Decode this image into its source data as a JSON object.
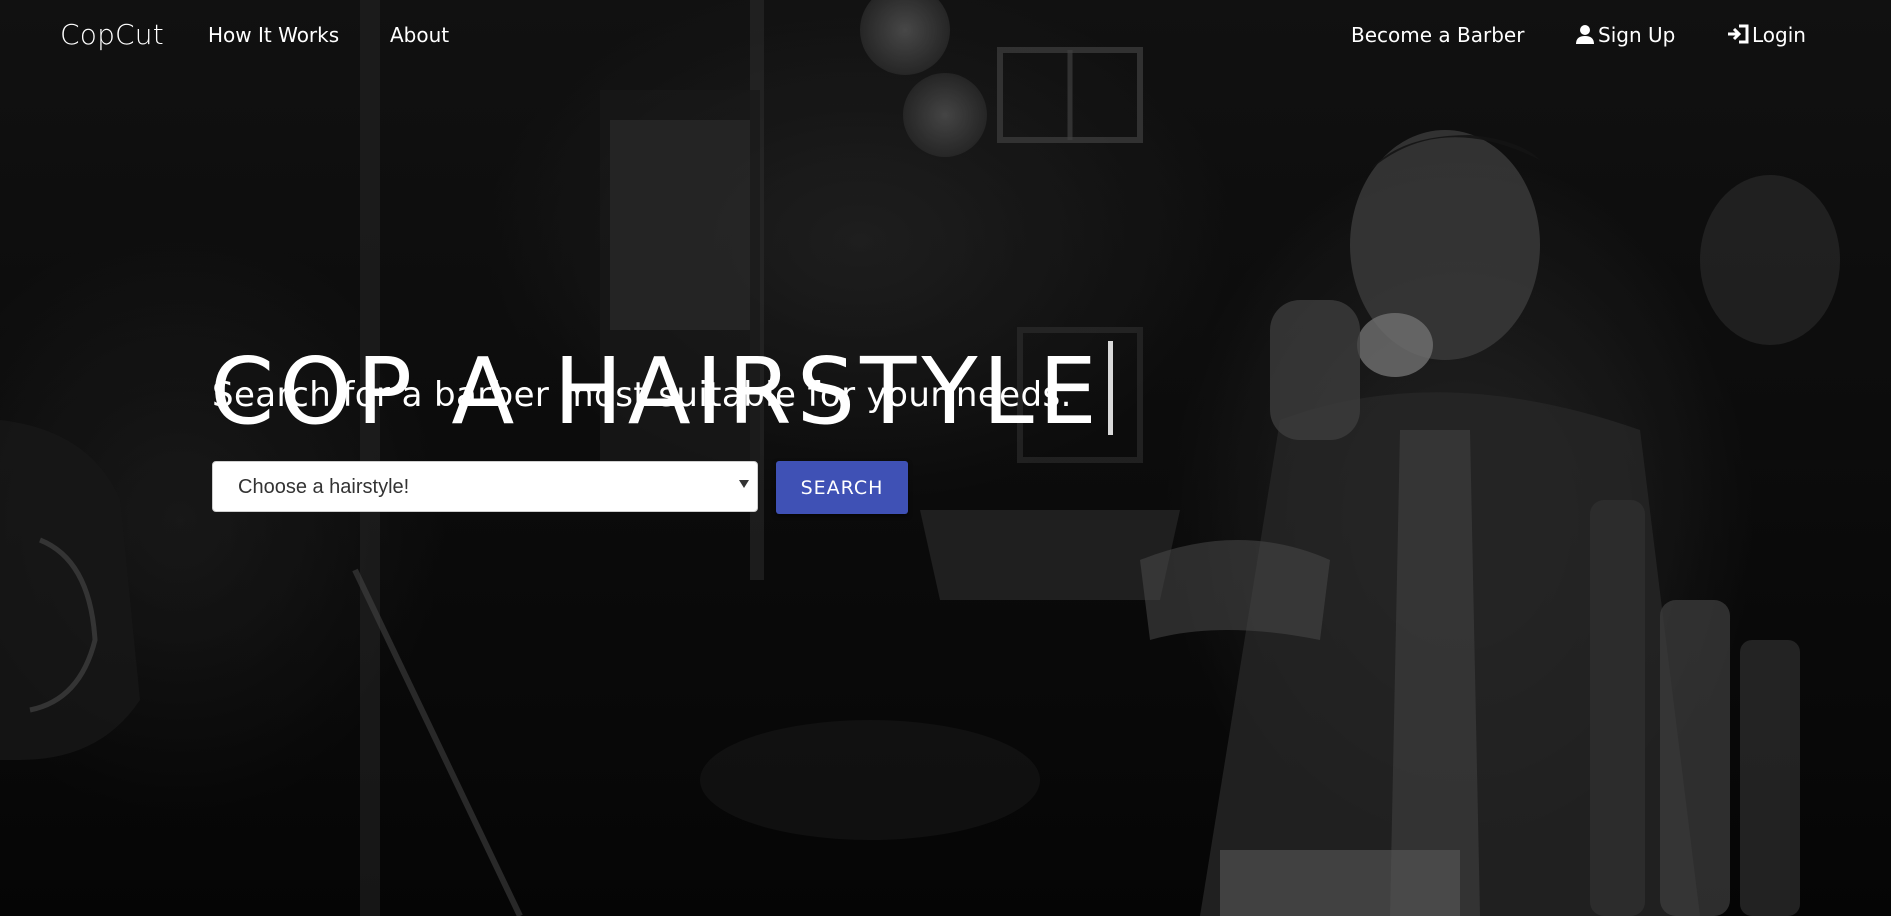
{
  "navbar": {
    "brand": "CopCut",
    "left_links": [
      "How It Works",
      "About"
    ],
    "right_links": {
      "become_barber": "Become a Barber",
      "sign_up": "Sign Up",
      "login": "Login"
    },
    "icons": {
      "sign_up": "user-icon",
      "login": "login-icon"
    }
  },
  "hero": {
    "title": "COP A HAIRSTYLE",
    "subtitle": "Search for a barber most suitable for your needs."
  },
  "search": {
    "select_value": "Choose a hairstyle!",
    "button_label": "SEARCH",
    "button_color": "#3f51b5"
  }
}
